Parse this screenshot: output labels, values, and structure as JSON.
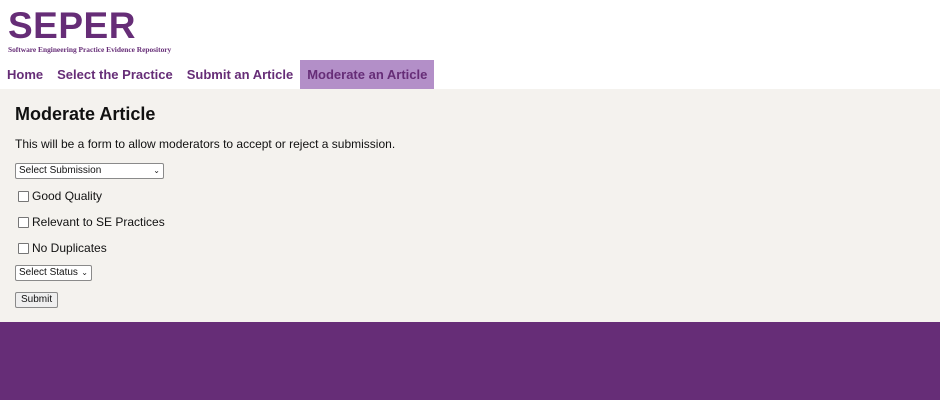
{
  "brand": {
    "title": "SEPER",
    "subtitle": "Software Engineering Practice Evidence Repository",
    "color": "#662d77"
  },
  "nav": {
    "items": [
      {
        "label": "Home"
      },
      {
        "label": "Select the Practice"
      },
      {
        "label": "Submit an Article"
      },
      {
        "label": "Moderate an Article",
        "active": true
      }
    ],
    "active_color": "#b38fc8"
  },
  "main": {
    "title": "Moderate Article",
    "description": "This will be a form to allow moderators to accept or reject a submission.",
    "submission_select": {
      "selected": "Select Submission"
    },
    "checkboxes": [
      {
        "label": "Good Quality",
        "checked": false
      },
      {
        "label": "Relevant to SE Practices",
        "checked": false
      },
      {
        "label": "No Duplicates",
        "checked": false
      }
    ],
    "status_select": {
      "selected": "Select Status"
    },
    "submit_label": "Submit",
    "background": "#f4f2ee"
  },
  "footer": {
    "color": "#662d77"
  }
}
